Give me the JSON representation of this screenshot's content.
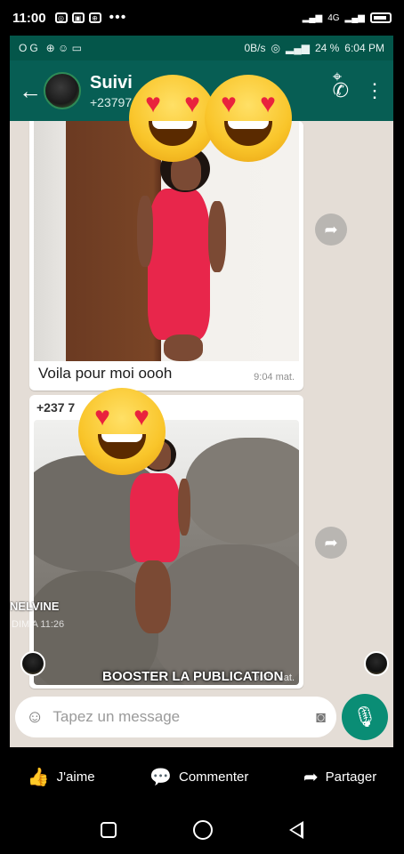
{
  "os_status": {
    "time": "11:00",
    "dots": "•••",
    "network": "4G"
  },
  "whatsapp_status": {
    "left_icons": "OG",
    "speed": "0B/s",
    "battery": "24 %",
    "time": "6:04 PM"
  },
  "chat_header": {
    "contact_name": "Suivi",
    "contact_number": "+23797"
  },
  "messages": [
    {
      "caption": "Voila pour moi oooh",
      "time": "9:04 mat."
    },
    {
      "sender": "+237 7",
      "time": "9:05 mat."
    }
  ],
  "viewer_overlay": {
    "name": "NELVINE",
    "time": "DIM A 11:26"
  },
  "composer": {
    "placeholder": "Tapez un message"
  },
  "boost_label": "BOOSTER LA PUBLICATION",
  "fb_actions": {
    "like": "J'aime",
    "comment": "Commenter",
    "share": "Partager"
  },
  "icons": {
    "emoji": "smiling-face-with-heart-eyes",
    "back": "arrow-left",
    "add_call": "phone-plus",
    "menu": "vertical-dots",
    "forward": "forward-arrow",
    "mic": "microphone"
  }
}
